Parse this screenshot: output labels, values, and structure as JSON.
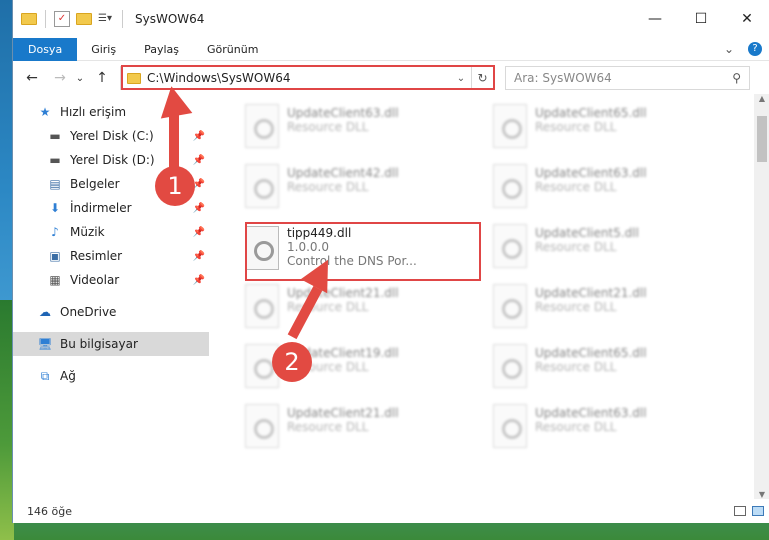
{
  "window": {
    "title": "SysWOW64",
    "minimize": "—",
    "maximize": "☐",
    "close": "✕"
  },
  "ribbon": {
    "tabs": [
      "Dosya",
      "Giriş",
      "Paylaş",
      "Görünüm"
    ],
    "expand": "⌄",
    "help": "?"
  },
  "nav": {
    "back": "←",
    "forward": "→",
    "recent": "⌄",
    "up": "↑"
  },
  "address": {
    "path": "C:\\Windows\\SysWOW64",
    "dropdown": "⌄",
    "refresh": "↻"
  },
  "search": {
    "placeholder": "Ara: SysWOW64",
    "icon": "search-icon"
  },
  "sidebar": {
    "items": [
      {
        "label": "Hızlı erişim",
        "icon": "star-icon"
      },
      {
        "label": "Yerel Disk (C:)",
        "icon": "drive-icon"
      },
      {
        "label": "Yerel Disk (D:)",
        "icon": "drive-icon"
      },
      {
        "label": "Belgeler",
        "icon": "document-icon"
      },
      {
        "label": "İndirmeler",
        "icon": "download-icon"
      },
      {
        "label": "Müzik",
        "icon": "music-icon"
      },
      {
        "label": "Resimler",
        "icon": "picture-icon"
      },
      {
        "label": "Videolar",
        "icon": "video-icon"
      },
      {
        "label": "OneDrive",
        "icon": "cloud-icon"
      },
      {
        "label": "Bu bilgisayar",
        "icon": "computer-icon"
      },
      {
        "label": "Ağ",
        "icon": "network-icon"
      }
    ]
  },
  "files": {
    "left": [
      {
        "name": "UpdateClient63.dll",
        "sub": "Resource DLL"
      },
      {
        "name": "UpdateClient42.dll",
        "sub": "Resource DLL"
      },
      {
        "name": "tipp449.dll",
        "version": "1.0.0.0",
        "desc": "Control the DNS Por..."
      },
      {
        "name": "UpdateClient21.dll",
        "sub": "Resource DLL"
      },
      {
        "name": "UpdateClient19.dll",
        "sub": "Resource DLL"
      },
      {
        "name": "UpdateClient21.dll",
        "sub": "Resource DLL"
      }
    ],
    "right": [
      {
        "name": "UpdateClient65.dll",
        "sub": "Resource DLL"
      },
      {
        "name": "UpdateClient63.dll",
        "sub": "Resource DLL"
      },
      {
        "name": "UpdateClient5.dll",
        "sub": "Resource DLL"
      },
      {
        "name": "UpdateClient21.dll",
        "sub": "Resource DLL"
      },
      {
        "name": "UpdateClient65.dll",
        "sub": "Resource DLL"
      },
      {
        "name": "UpdateClient63.dll",
        "sub": "Resource DLL"
      }
    ]
  },
  "status": {
    "count": "146 öğe"
  },
  "annotations": {
    "one": "1",
    "two": "2",
    "color": "#e24a42"
  }
}
